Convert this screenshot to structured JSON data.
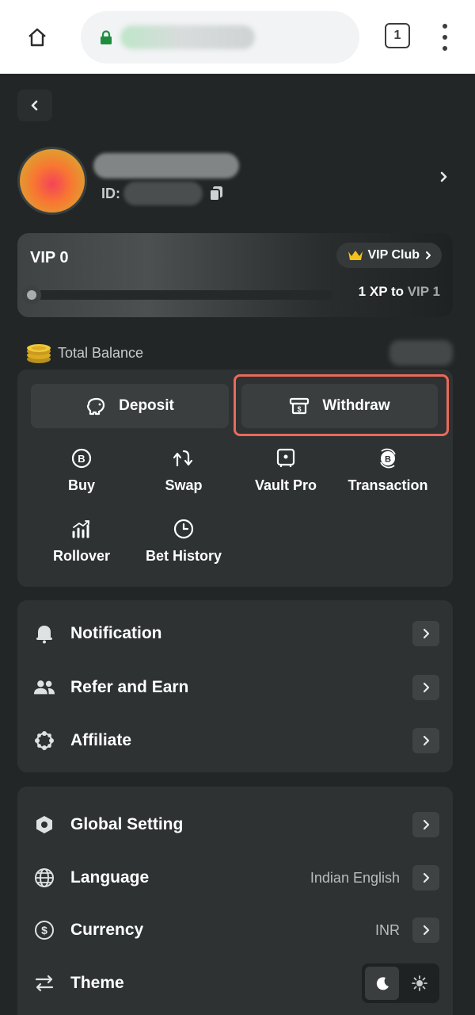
{
  "browser": {
    "tab_count": "1",
    "icons": [
      "home-icon",
      "lock-icon",
      "overflow-menu-icon"
    ]
  },
  "profile": {
    "id_label": "ID:"
  },
  "vip": {
    "title": "VIP 0",
    "club_label": "VIP Club",
    "next_prefix": "1 XP to ",
    "next_level": "VIP 1",
    "progress": 0
  },
  "balance": {
    "label": "Total Balance"
  },
  "wallet": {
    "deposit_label": "Deposit",
    "withdraw_label": "Withdraw",
    "highlight_color": "#e96a5a",
    "actions": [
      {
        "label": "Buy",
        "icon": "bitcoin-circle-icon"
      },
      {
        "label": "Swap",
        "icon": "swap-arrows-icon"
      },
      {
        "label": "Vault Pro",
        "icon": "vault-icon"
      },
      {
        "label": "Transaction",
        "icon": "transaction-icon"
      },
      {
        "label": "Rollover",
        "icon": "rollover-chart-icon"
      },
      {
        "label": "Bet History",
        "icon": "clock-icon"
      }
    ]
  },
  "menu1": {
    "items": [
      {
        "label": "Notification",
        "icon": "bell-icon"
      },
      {
        "label": "Refer and Earn",
        "icon": "users-icon"
      },
      {
        "label": "Affiliate",
        "icon": "affiliate-icon"
      }
    ]
  },
  "menu2": {
    "items": [
      {
        "label": "Global Setting",
        "icon": "hexagon-gear-icon",
        "value": ""
      },
      {
        "label": "Language",
        "icon": "globe-icon",
        "value": "Indian English"
      },
      {
        "label": "Currency",
        "icon": "dollar-circle-icon",
        "value": "INR"
      },
      {
        "label": "Theme",
        "icon": "sliders-icon",
        "value": ""
      }
    ],
    "theme": {
      "selected": "dark",
      "options": [
        "moon-icon",
        "sun-icon"
      ]
    }
  },
  "colors": {
    "background": "#232626",
    "card": "#2e3233",
    "button": "#3a3e3f",
    "text": "#ffffff",
    "muted": "#b9bdbd"
  }
}
